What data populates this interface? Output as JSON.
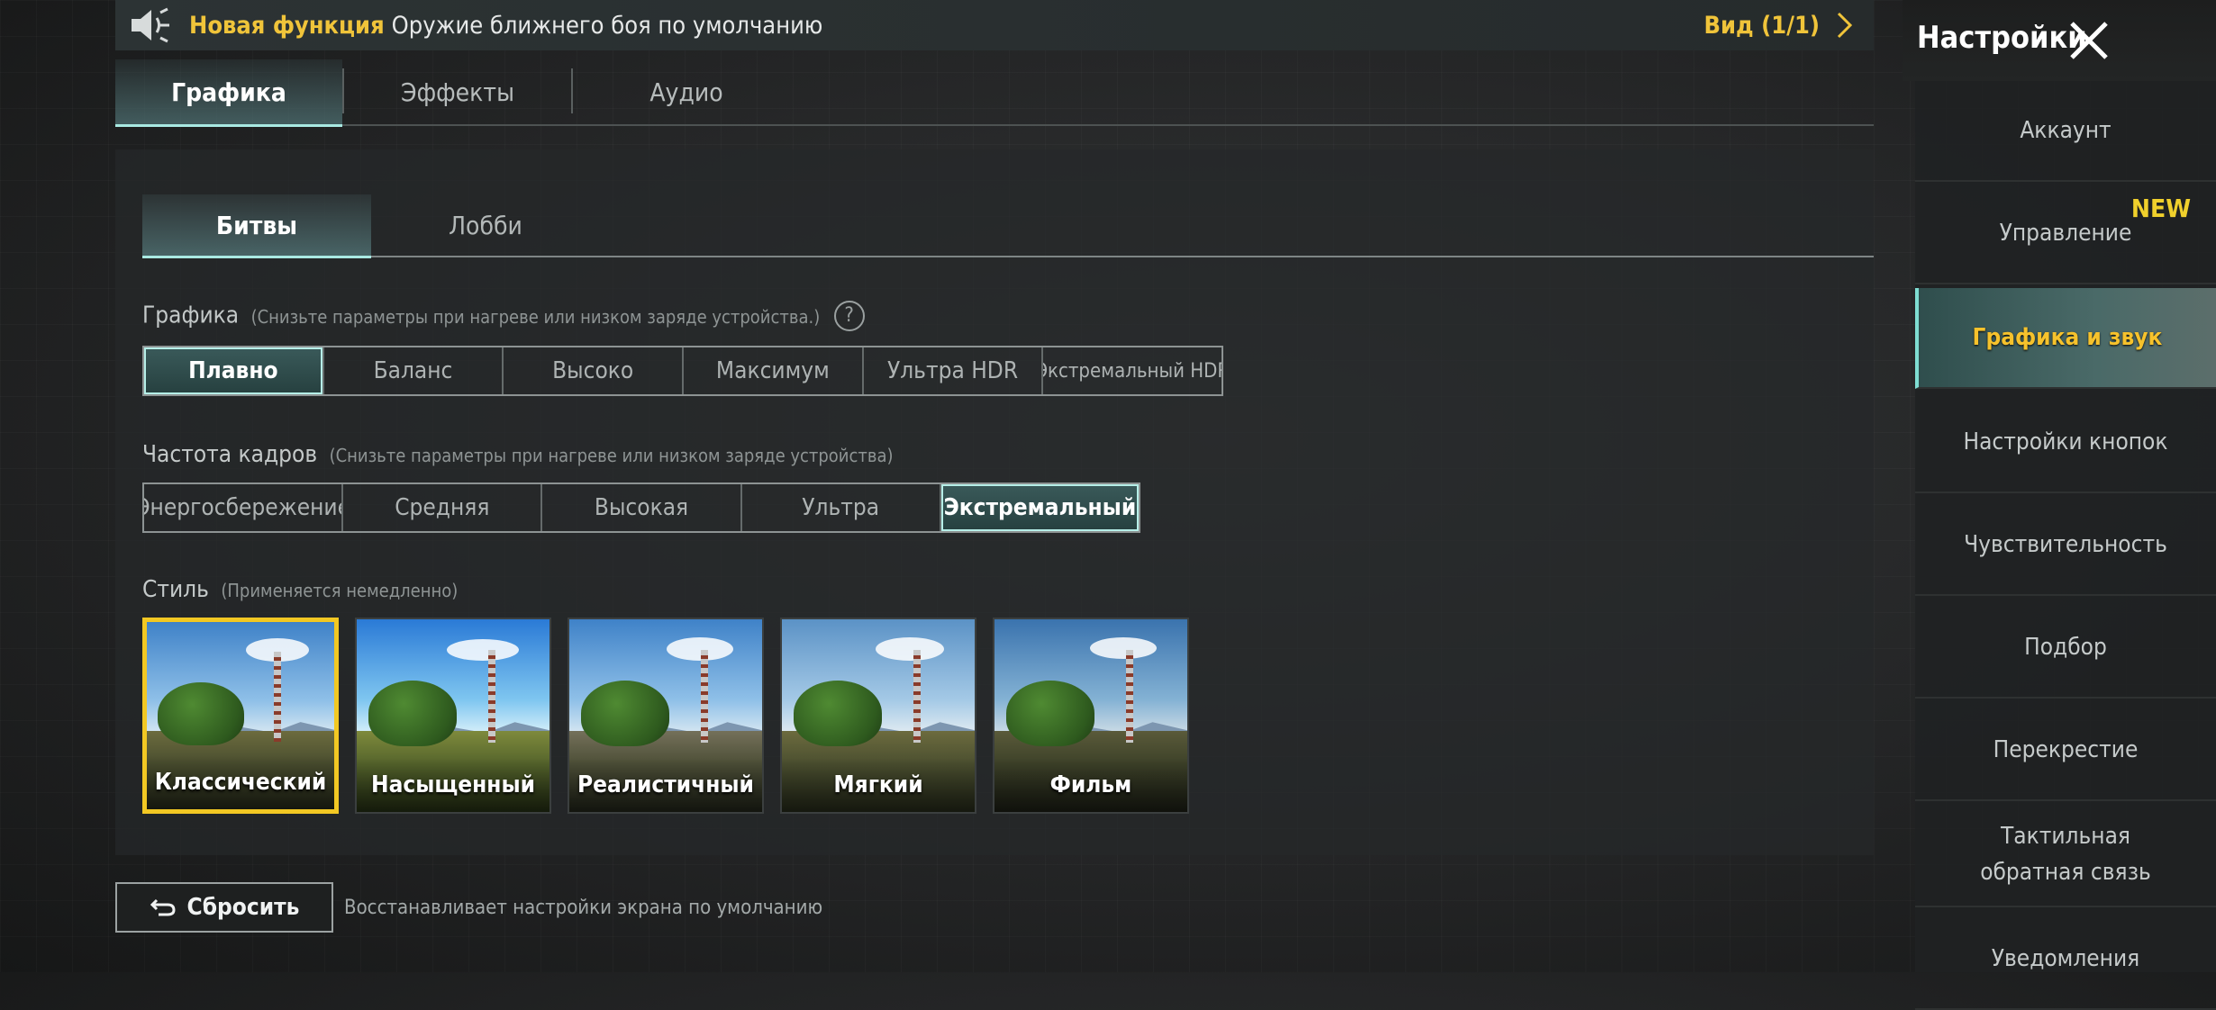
{
  "announcement": {
    "highlight": "Новая функция",
    "message": "Оружие ближнего боя по умолчанию",
    "view": "Вид (1/1)"
  },
  "main_tabs": [
    {
      "label": "Графика",
      "active": true
    },
    {
      "label": "Эффекты",
      "active": false
    },
    {
      "label": "Аудио",
      "active": false
    }
  ],
  "sub_tabs": [
    {
      "label": "Битвы",
      "active": true
    },
    {
      "label": "Лобби",
      "active": false
    }
  ],
  "graphics": {
    "label": "Графика",
    "note": "(Снизьте параметры при нагреве или низком заряде устройства.)",
    "options": [
      "Плавно",
      "Баланс",
      "Высоко",
      "Максимум",
      "Ультра HDR",
      "Экстремальный HDR"
    ],
    "selected": "Плавно"
  },
  "framerate": {
    "label": "Частота кадров",
    "note": "(Снизьте параметры при нагреве или низком заряде устройства)",
    "options": [
      "Энергосбережение",
      "Средняя",
      "Высокая",
      "Ультра",
      "Экстремальный"
    ],
    "selected": "Экстремальный"
  },
  "style": {
    "label": "Стиль",
    "note": "(Применяется немедленно)",
    "options": [
      "Классический",
      "Насыщенный",
      "Реалистичный",
      "Мягкий",
      "Фильм"
    ],
    "selected": "Классический"
  },
  "reset": {
    "label": "Сбросить",
    "description": "Восстанавливает настройки экрана по умолчанию"
  },
  "sidebar": {
    "title": "Настройки",
    "items": [
      {
        "label": "Аккаунт"
      },
      {
        "label": "Управление",
        "badge": "NEW"
      },
      {
        "label": "Графика и звук",
        "active": true
      },
      {
        "label": "Настройки кнопок"
      },
      {
        "label": "Чувствительность"
      },
      {
        "label": "Подбор"
      },
      {
        "label": "Перекрестие"
      },
      {
        "label": "Тактильная обратная связь"
      },
      {
        "label": "Уведомления"
      }
    ]
  },
  "colors": {
    "accent_yellow": "#f0c43a",
    "accent_teal": "#a9e9e2",
    "selected_border": "#f2c823"
  }
}
